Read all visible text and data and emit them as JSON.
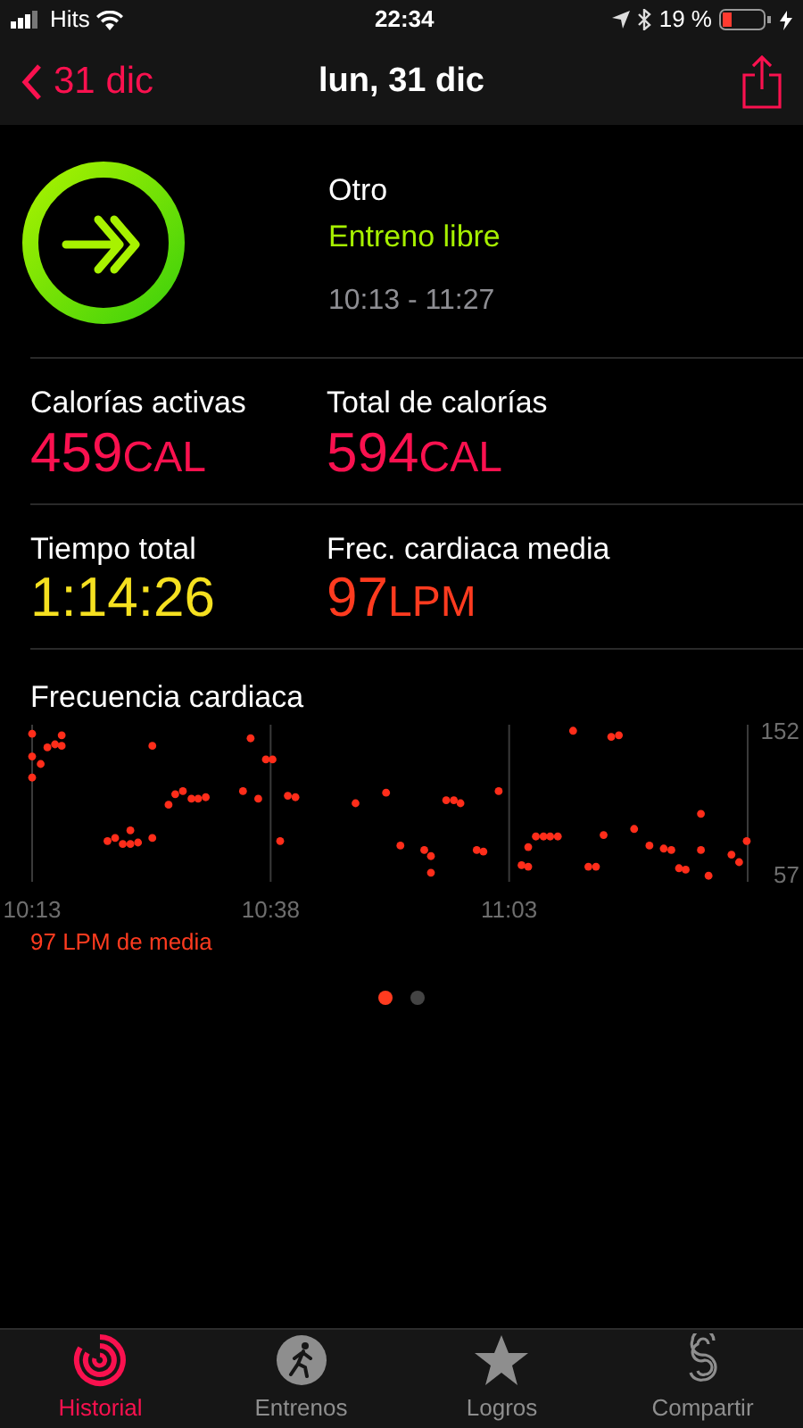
{
  "status_bar": {
    "carrier": "Hits",
    "time": "22:34",
    "battery": "19 %"
  },
  "nav": {
    "back": "31 dic",
    "title": "lun, 31 dic"
  },
  "workout": {
    "type": "Otro",
    "name": "Entreno libre",
    "time_range": "10:13 - 11:27"
  },
  "metrics": [
    {
      "label": "Calorías activas",
      "value": "459",
      "unit": "CAL",
      "color": "#fa114f"
    },
    {
      "label": "Total de calorías",
      "value": "594",
      "unit": "CAL",
      "color": "#fa114f"
    },
    {
      "label": "Tiempo total",
      "value": "1:14:26",
      "color": "#f5e020"
    },
    {
      "label": "Frec. cardiaca media",
      "value": "97",
      "unit": "LPM",
      "color": "#ff3b1f"
    }
  ],
  "heart_rate": {
    "title": "Frecuencia cardiaca",
    "average": "97 LPM de media",
    "chart_data": {
      "type": "scatter",
      "xlim": [
        613,
        688
      ],
      "ylim": [
        52,
        156
      ],
      "xticks": [
        {
          "value": 613,
          "label": "10:13"
        },
        {
          "value": 638,
          "label": "10:38"
        },
        {
          "value": 663,
          "label": "11:03"
        }
      ],
      "yticks": [
        57,
        152
      ],
      "series": [
        {
          "color": "#ff2d1a",
          "x": [
            613,
            613,
            613.9,
            613,
            614.6,
            615.4,
            616.1,
            616.1,
            620.9,
            621.7,
            622.5,
            623.3,
            623.3,
            624.1,
            625.6,
            625.6,
            627.3,
            628,
            628.8,
            629.7,
            630.4,
            631.2,
            635.1,
            635.9,
            636.7,
            637.5,
            638.2,
            639,
            639.8,
            640.6,
            646.9,
            650.1,
            651.6,
            654.1,
            654.8,
            654.8,
            656.4,
            657.2,
            657.9,
            659.6,
            660.3,
            661.9,
            664.3,
            665,
            665,
            665.8,
            666.6,
            667.3,
            668.1,
            669.7,
            671.3,
            672.1,
            672.9,
            673.7,
            674.5,
            676.1,
            677.7,
            679.2,
            680,
            680.8,
            681.5,
            683.1,
            683.1,
            683.9,
            686.3,
            687.1,
            687.9
          ],
          "values": [
            150,
            135,
            130,
            121,
            141,
            143,
            149,
            142,
            79,
            81,
            77,
            86,
            77,
            78,
            142,
            81,
            103,
            110,
            112,
            107,
            107,
            108,
            112,
            147,
            107,
            133,
            133,
            79,
            109,
            108,
            104,
            111,
            76,
            73,
            69,
            58,
            106,
            106,
            104,
            73,
            72,
            112,
            63,
            62,
            75,
            82,
            82,
            82,
            82,
            152,
            62,
            62,
            83,
            148,
            149,
            87,
            76,
            74,
            73,
            61,
            60,
            97,
            73,
            56,
            70,
            65,
            79
          ]
        }
      ]
    }
  },
  "pages": [
    {
      "selected": true
    },
    {
      "selected": false
    }
  ],
  "tabs": [
    {
      "label": "Historial",
      "kind": "rings",
      "selected": true
    },
    {
      "label": "Entrenos",
      "kind": "runner",
      "selected": false
    },
    {
      "label": "Logros",
      "kind": "star",
      "selected": false
    },
    {
      "label": "Compartir",
      "kind": "share",
      "selected": false
    }
  ]
}
